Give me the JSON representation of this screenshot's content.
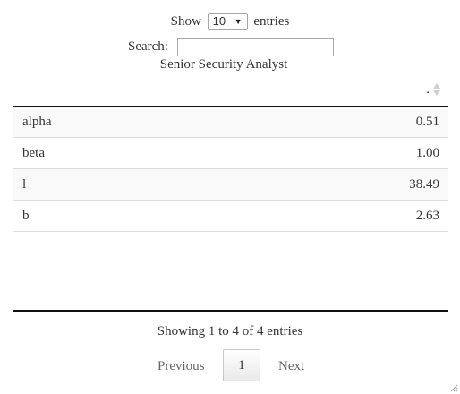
{
  "length_menu": {
    "prefix": "Show",
    "selected": "10",
    "suffix": "entries"
  },
  "search": {
    "label": "Search:",
    "value": ""
  },
  "table": {
    "caption": "Senior Security Analyst",
    "value_header": ".",
    "rows": [
      {
        "label": "alpha",
        "value": "0.51"
      },
      {
        "label": "beta",
        "value": "1.00"
      },
      {
        "label": "l",
        "value": "38.49"
      },
      {
        "label": "b",
        "value": "2.63"
      }
    ]
  },
  "info": "Showing 1 to 4 of 4 entries",
  "pagination": {
    "previous": "Previous",
    "current_page": "1",
    "next": "Next"
  },
  "colors": {
    "odd_row": "#f9f9f9",
    "rule": "#111111",
    "row_border": "#dddddd"
  },
  "icons": {
    "sort": "sort-both-icon",
    "dropdown": "chevron-down-icon",
    "resize": "resize-grip-icon"
  }
}
